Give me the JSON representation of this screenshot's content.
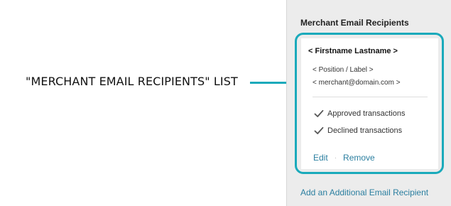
{
  "callout": {
    "label": "\"MERCHANT EMAIL RECIPIENTS\" LIST",
    "accent_color": "#1aaabb"
  },
  "panel": {
    "title": "Merchant Email Recipients",
    "recipient": {
      "name": "< Firstname Lastname >",
      "position": "< Position / Label >",
      "email": "< merchant@domain.com >",
      "notifications": [
        {
          "icon": "checkmark-icon",
          "label": "Approved transactions"
        },
        {
          "icon": "checkmark-icon",
          "label": "Declined transactions"
        }
      ],
      "actions": {
        "edit_label": "Edit",
        "separator": "·",
        "remove_label": "Remove"
      }
    },
    "add_recipient_label": "Add an Additional Email Recipient",
    "link_color": "#2b7fa0"
  }
}
